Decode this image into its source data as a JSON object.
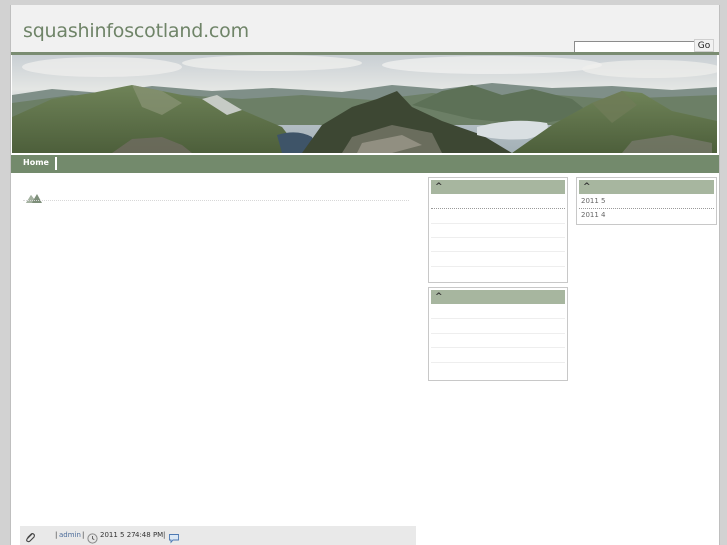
{
  "site": {
    "title": "squashinfoscotland.com"
  },
  "search": {
    "placeholder": "",
    "button_label": "Go"
  },
  "nav": {
    "items": [
      {
        "label": "Home"
      }
    ]
  },
  "widgets": {
    "widget1": {
      "heading": "^"
    },
    "widget2": {
      "heading": "^"
    },
    "archive": {
      "heading": "^",
      "items": [
        {
          "label": "2011 5"
        },
        {
          "label": "2011 4"
        }
      ]
    }
  },
  "post_meta": {
    "author_sep": "|",
    "author": "admin",
    "date_sep": "|",
    "date": "2011 5 27",
    "time": "4:48 PM",
    "comments_sep": "|"
  },
  "colors": {
    "accent": "#738a6c",
    "widget_header": "#a7b69f",
    "title": "#6f8468"
  }
}
